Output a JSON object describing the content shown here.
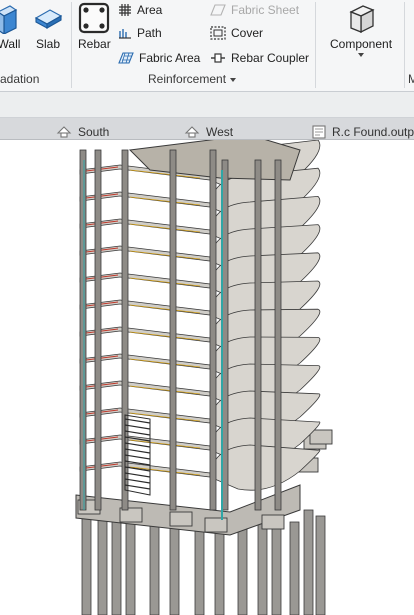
{
  "ribbon": {
    "wall_label": "Wall",
    "slab_label": "Slab",
    "foundation_panel_title": "adation",
    "rebar_label": "Rebar",
    "area_label": "Area",
    "path_label": "Path",
    "fabric_area_label": "Fabric  Area",
    "fabric_sheet_label": "Fabric  Sheet",
    "cover_label": "Cover",
    "rebar_coupler_label": "Rebar  Coupler",
    "reinforcement_panel_title": "Reinforcement",
    "component_label": "Component",
    "next_panel_title": "M"
  },
  "view_tabs": [
    {
      "label": "South",
      "icon": "elevation-icon"
    },
    {
      "label": "West",
      "icon": "elevation-icon"
    },
    {
      "label": "R.c Found.outp",
      "icon": "sheet-icon"
    }
  ],
  "colors": {
    "ribbon_bg": "#f5f6f7",
    "slab_fill": "#cfcdc8",
    "structure_stroke": "#3a3a3a",
    "rebar_accent": "#2fa6a6"
  }
}
